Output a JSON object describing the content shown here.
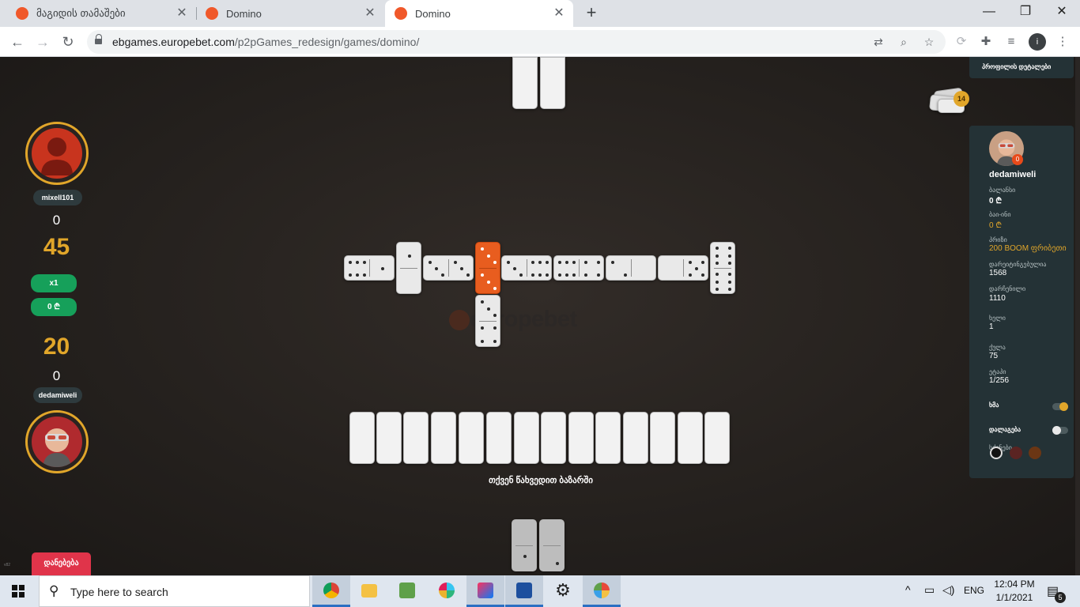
{
  "browser": {
    "tabs": [
      {
        "title": "მაგიდის თამაშები",
        "active": false
      },
      {
        "title": "Domino",
        "active": false
      },
      {
        "title": "Domino",
        "active": true
      }
    ],
    "new_tab_label": "+",
    "window_controls": {
      "minimize": "—",
      "maximize": "❐",
      "close": "✕"
    },
    "url_host": "ebgames.europebet.com",
    "url_path": "/p2pGames_redesign/games/domino/",
    "profile_initial": "i"
  },
  "game": {
    "opponent": {
      "name": "mixell101",
      "points": "0",
      "score": "45",
      "multiplier": "x1",
      "bet": "0 ₾"
    },
    "player": {
      "score": "20",
      "points": "0",
      "name": "dedamiweli"
    },
    "boneyard_count": "14",
    "watermark": "europebet",
    "hand_label": "თქვენ წახვედით ბაზარში",
    "leave_button": "დანებება",
    "leave_small": "v82",
    "colors": {
      "accent": "#e1a62a",
      "green": "#16a05a",
      "red": "#e0344a",
      "orange": "#e85d1f"
    }
  },
  "panel": {
    "top_label": "პროფილის დეტალები",
    "username": "dedamiweli",
    "badge": "0",
    "rows": [
      {
        "label": "ბალანსი",
        "value": "0 ₾"
      },
      {
        "label": "ბაი-ინი",
        "value": "0 ₾"
      },
      {
        "label": "პრიზი",
        "value": "200 BOOM ფრიბეთი"
      },
      {
        "label": "დარეიტინგებულია",
        "value": "1568"
      },
      {
        "label": "დარჩენილი",
        "value": "1110"
      },
      {
        "label": "ხელი",
        "value": "1"
      },
      {
        "label": "ქულა",
        "value": "75"
      },
      {
        "label": "ეტაპი",
        "value": "1/256"
      }
    ],
    "sound_label": "ხმა",
    "sound_on": true,
    "hints_label": "დალაგება",
    "hints_on": false,
    "table_color_label": "სქინები",
    "swatches": [
      "#121212",
      "#5a2422",
      "#6b3614"
    ]
  },
  "taskbar": {
    "search_placeholder": "Type here to search",
    "apps": [
      "chrome-icon",
      "file-explorer-icon",
      "notepad-icon",
      "slack-icon",
      "jetbrains-icon",
      "screen-recorder-icon",
      "settings-icon",
      "paint-icon"
    ],
    "language": "ENG",
    "time": "12:04 PM",
    "date": "1/1/2021",
    "notification_count": "5"
  }
}
